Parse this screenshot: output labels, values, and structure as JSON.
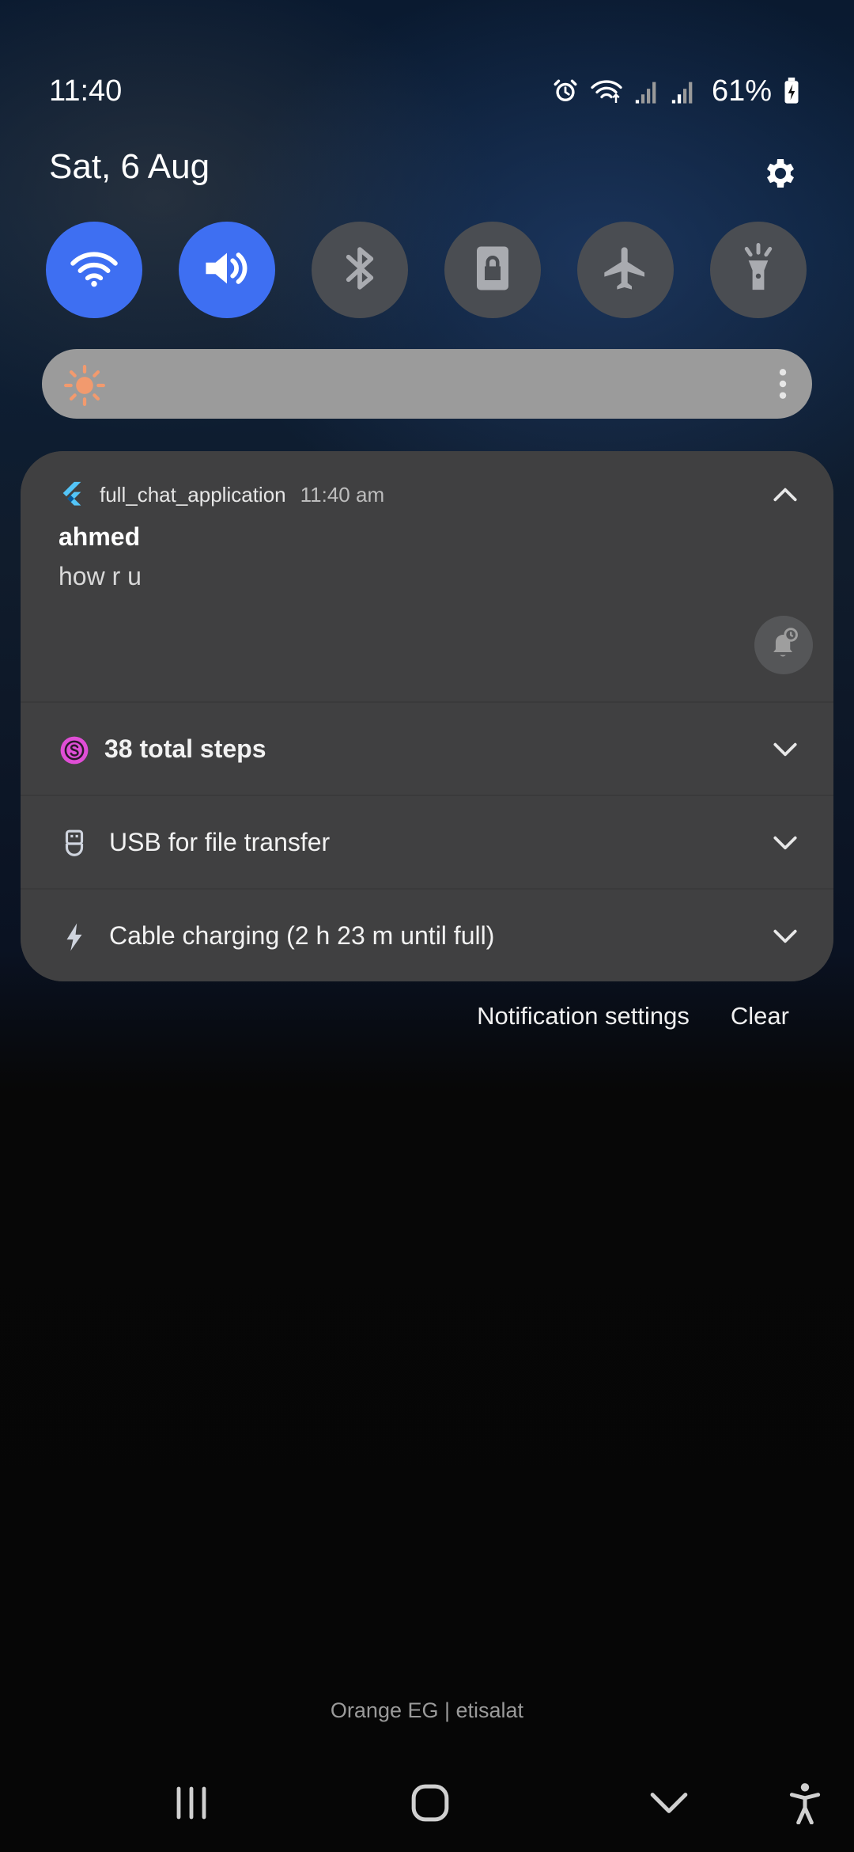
{
  "status_bar": {
    "time": "11:40",
    "battery": "61%",
    "icons": [
      "alarm-icon",
      "wifi-icon",
      "signal-icon",
      "signal-icon",
      "battery-charging-icon"
    ]
  },
  "header": {
    "date": "Sat, 6 Aug",
    "settings_icon": "gear-icon"
  },
  "quick_settings": [
    {
      "name": "wifi",
      "icon": "wifi-icon",
      "state": "on"
    },
    {
      "name": "sound",
      "icon": "speaker-icon",
      "state": "on"
    },
    {
      "name": "bluetooth",
      "icon": "bluetooth-icon",
      "state": "off"
    },
    {
      "name": "rotation-lock",
      "icon": "portrait-lock-icon",
      "state": "off"
    },
    {
      "name": "airplane-mode",
      "icon": "airplane-icon",
      "state": "off"
    },
    {
      "name": "flashlight",
      "icon": "flashlight-icon",
      "state": "off"
    }
  ],
  "brightness": {
    "icon": "sun-icon",
    "more_icon": "more-vert-icon"
  },
  "notifications": {
    "chat": {
      "app": "full_chat_application",
      "time": "11:40 am",
      "sender": "ahmed",
      "message": "how r u"
    },
    "steps": {
      "label": "38 total steps"
    },
    "usb": {
      "label": "USB for file transfer"
    },
    "charging": {
      "label": "Cable charging (2 h 23 m until full)"
    }
  },
  "actions": {
    "notification_settings": "Notification settings",
    "clear": "Clear"
  },
  "carrier": "Orange EG | etisalat",
  "colors": {
    "accent": "#3e6ff2",
    "tile_off": "#4a4d52",
    "card": "#404041",
    "steps_badge": "#e04ed6"
  }
}
